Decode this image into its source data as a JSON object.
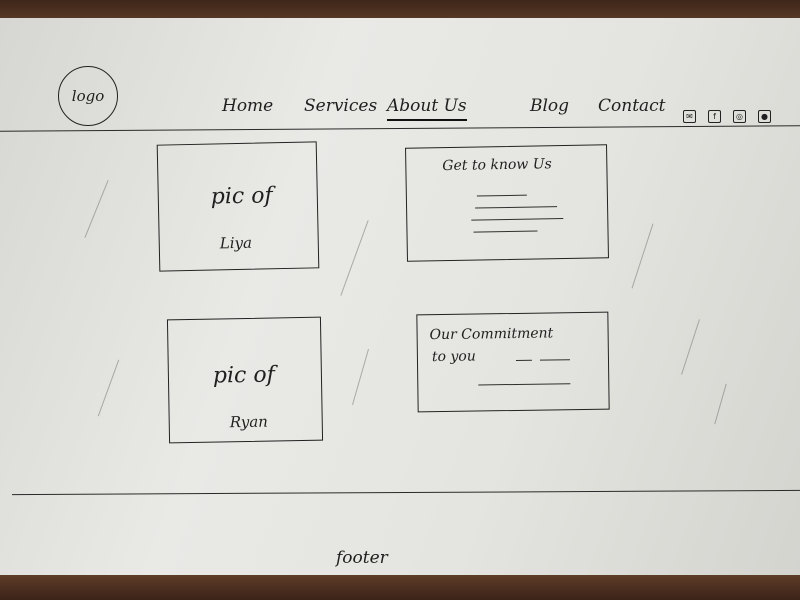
{
  "header": {
    "logo_text": "logo",
    "nav": [
      {
        "label": "Home"
      },
      {
        "label": "Services"
      },
      {
        "label": "About Us"
      },
      {
        "label": "Blog"
      },
      {
        "label": "Contact"
      }
    ],
    "active_nav": "About Us",
    "social_icons": [
      "mail-icon",
      "facebook-icon",
      "social-icon",
      "instagram-icon"
    ]
  },
  "main": {
    "photos": [
      {
        "line1": "pic of",
        "line2": "Liya"
      },
      {
        "line1": "pic of",
        "line2": "Ryan"
      }
    ],
    "cards": [
      {
        "title": "Get to know Us"
      },
      {
        "title_line1": "Our Commitment",
        "title_line2": "to you"
      }
    ]
  },
  "footer": {
    "label": "footer"
  }
}
